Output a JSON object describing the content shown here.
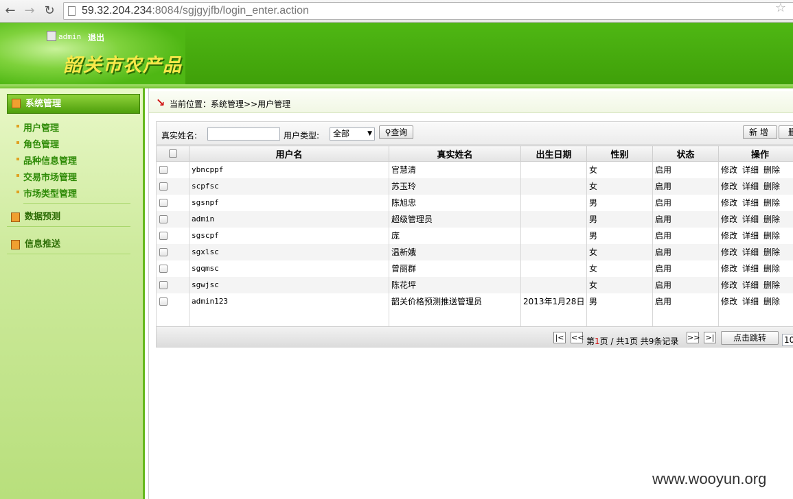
{
  "browser": {
    "url_host": "59.32.204.234",
    "url_path": ":8084/sgjgyjfb/login_enter.action"
  },
  "header": {
    "username": "admin",
    "logout": "退出",
    "site_title": "韶关市农产品"
  },
  "sidebar": {
    "active_section": "系统管理",
    "sub_items": [
      "用户管理",
      "角色管理",
      "品种信息管理",
      "交易市场管理",
      "市场类型管理"
    ],
    "sections": [
      "数据预测",
      "信息推送"
    ]
  },
  "location": {
    "label": "当前位置：",
    "path": "系统管理>>用户管理"
  },
  "search": {
    "realname_label": "真实姓名:",
    "usertype_label": "用户类型:",
    "usertype_value": "全部",
    "query_button": "查询",
    "add_button": "新增",
    "delete_button": "删"
  },
  "table": {
    "headers": [
      "",
      "用户名",
      "真实姓名",
      "出生日期",
      "性别",
      "状态",
      "操作"
    ],
    "ops": [
      "修改",
      "详细",
      "删除"
    ],
    "rows": [
      {
        "username": "ybncppf",
        "realname": "官慧清",
        "birth": "",
        "gender": "女",
        "status": "启用"
      },
      {
        "username": "scpfsc",
        "realname": "苏玉玲",
        "birth": "",
        "gender": "女",
        "status": "启用"
      },
      {
        "username": "sgsnpf",
        "realname": "陈旭忠",
        "birth": "",
        "gender": "男",
        "status": "启用"
      },
      {
        "username": "admin",
        "realname": "超级管理员",
        "birth": "",
        "gender": "男",
        "status": "启用"
      },
      {
        "username": "sgscpf",
        "realname": "庞",
        "birth": "",
        "gender": "男",
        "status": "启用"
      },
      {
        "username": "sgxlsc",
        "realname": "温新娥",
        "birth": "",
        "gender": "女",
        "status": "启用"
      },
      {
        "username": "sgqmsc",
        "realname": "曾丽群",
        "birth": "",
        "gender": "女",
        "status": "启用"
      },
      {
        "username": "sgwjsc",
        "realname": "陈花坪",
        "birth": "",
        "gender": "女",
        "status": "启用"
      },
      {
        "username": "admin123",
        "realname": "韶关价格预测推送管理员",
        "birth": "2013年1月28日",
        "gender": "男",
        "status": "启用"
      }
    ]
  },
  "pager": {
    "first": "|<",
    "prev": "<<",
    "next": ">>",
    "last": ">|",
    "page_prefix": "第",
    "current_page": "1",
    "page_suffix": "页 / 共1页 共9条记录",
    "jump_button": "点击跳转",
    "jump_value": "10"
  },
  "watermark": "www.wooyun.org"
}
